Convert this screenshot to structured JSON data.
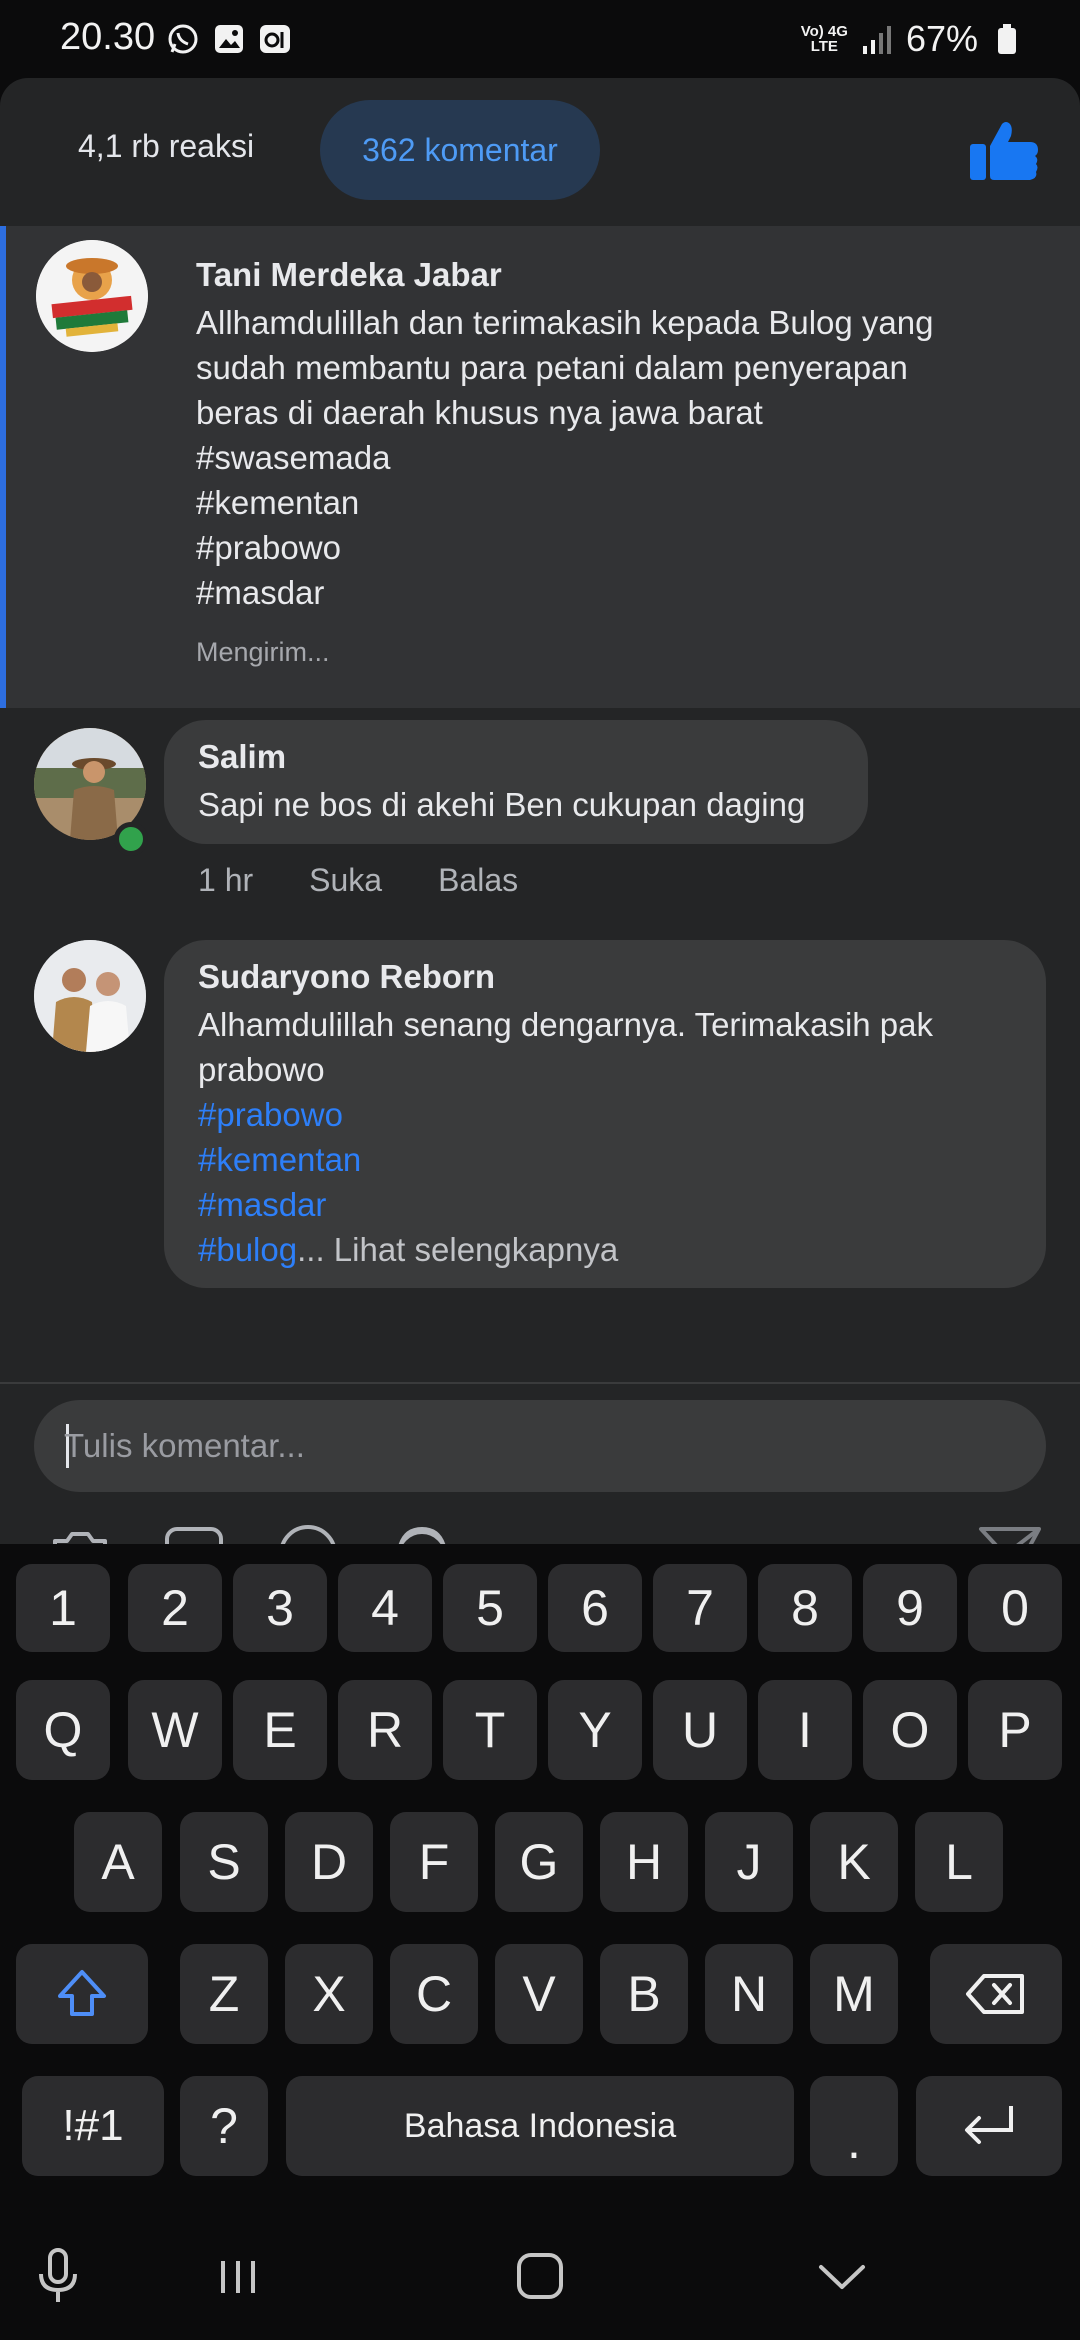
{
  "status_bar": {
    "time": "20.30",
    "network_top": "Vo) 4G",
    "network_bottom": "LTE",
    "battery": "67%"
  },
  "header": {
    "reactions": "4,1 rb reaksi",
    "comments_tab": "362 komentar"
  },
  "comments": [
    {
      "author": "Tani Merdeka Jabar",
      "lines": [
        "Allhamdulillah dan terimakasih kepada Bulog yang",
        "sudah membantu para petani dalam penyerapan",
        "beras di daerah khusus nya jawa barat",
        "#swasemada",
        "#kementan",
        "#prabowo",
        "#masdar"
      ],
      "status": "Mengirim..."
    },
    {
      "author": "Salim",
      "text": "Sapi ne bos di akehi Ben cukupan daging",
      "time": "1 hr",
      "like": "Suka",
      "reply": "Balas"
    },
    {
      "author": "Sudaryono Reborn",
      "lines": [
        "Alhamdulillah senang dengarnya.  Terimakasih pak",
        "prabowo"
      ],
      "hashtags": [
        "#prabowo",
        "#kementan",
        "#masdar",
        "#bulog"
      ],
      "see_more": "... Lihat selengkapnya"
    }
  ],
  "composer": {
    "placeholder": "Tulis komentar..."
  },
  "keyboard": {
    "row_numbers": [
      "1",
      "2",
      "3",
      "4",
      "5",
      "6",
      "7",
      "8",
      "9",
      "0"
    ],
    "row_1": [
      "Q",
      "W",
      "E",
      "R",
      "T",
      "Y",
      "U",
      "I",
      "O",
      "P"
    ],
    "row_2": [
      "A",
      "S",
      "D",
      "F",
      "G",
      "H",
      "J",
      "K",
      "L"
    ],
    "row_3": [
      "Z",
      "X",
      "C",
      "V",
      "B",
      "N",
      "M"
    ],
    "symbols": "!#1",
    "question": "?",
    "space": "Bahasa Indonesia",
    "period": "."
  },
  "colors": {
    "accent": "#2d7ff9",
    "sheet_bg": "#242526",
    "bubble_bg": "#3a3b3c",
    "pill_bg": "#263951"
  }
}
